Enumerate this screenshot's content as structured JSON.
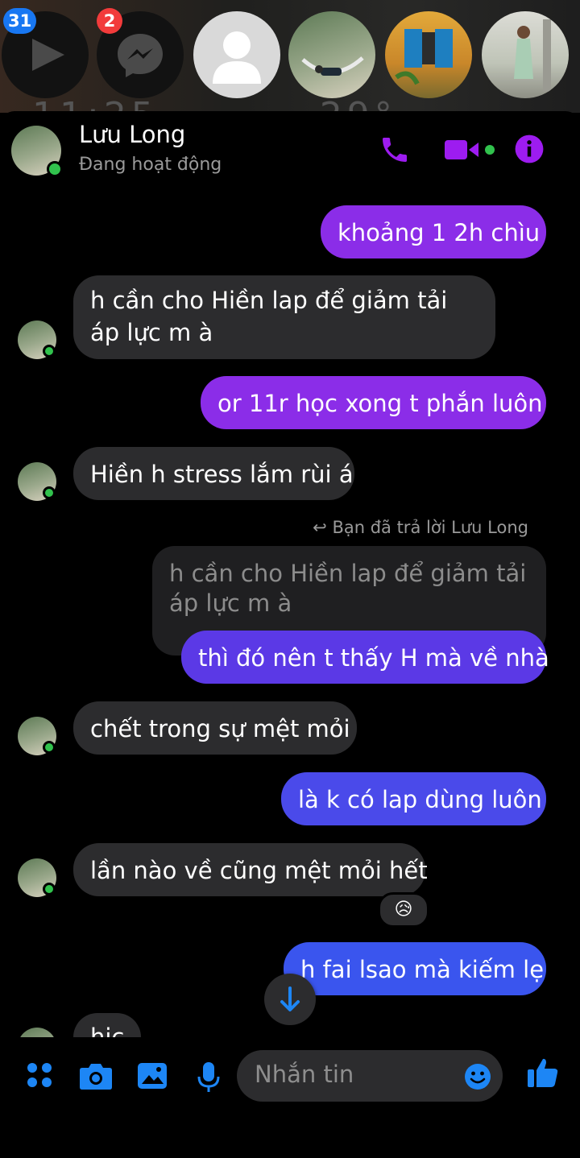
{
  "chat_heads": {
    "play_badge": "31",
    "messenger_badge": "2",
    "ghost_clock": "11:25",
    "ghost_temp": "29°"
  },
  "conversation": {
    "contact_name": "Lưu Long",
    "contact_status": "Đang hoạt động",
    "header_icons": [
      "phone-icon",
      "video-camera-icon",
      "info-icon"
    ],
    "accent_color": "#8b2de8"
  },
  "messages": [
    {
      "side": "out",
      "text": "khoảng 1 2h chìu"
    },
    {
      "side": "in",
      "text": "h cần cho Hiền lap để giảm tải áp lực m à"
    },
    {
      "side": "out",
      "text": "or 11r học xong t phắn luôn"
    },
    {
      "side": "in",
      "text": "Hiền h stress lắm rùi á"
    },
    {
      "side": "out",
      "reply_note": "Bạn đã trả lời Lưu Long",
      "quoted_text": "h cần cho Hiền lap để giảm tải áp lực m à",
      "text": "thì đó nên t thấy H mà về nhà"
    },
    {
      "side": "in",
      "text": "chết trong sự mệt mỏi"
    },
    {
      "side": "out",
      "text": "là k có lap dùng luôn"
    },
    {
      "side": "in",
      "text": "lần nào về cũng mệt mỏi hết",
      "reaction": "😥"
    },
    {
      "side": "out",
      "text": "h fai lsao mà kiếm lẹ"
    },
    {
      "side": "in",
      "text": "hic"
    }
  ],
  "composer": {
    "placeholder": "Nhắn tin",
    "icons": [
      "menu-grid-icon",
      "camera-icon",
      "gallery-icon",
      "microphone-icon",
      "emoji-icon",
      "like-icon"
    ]
  }
}
